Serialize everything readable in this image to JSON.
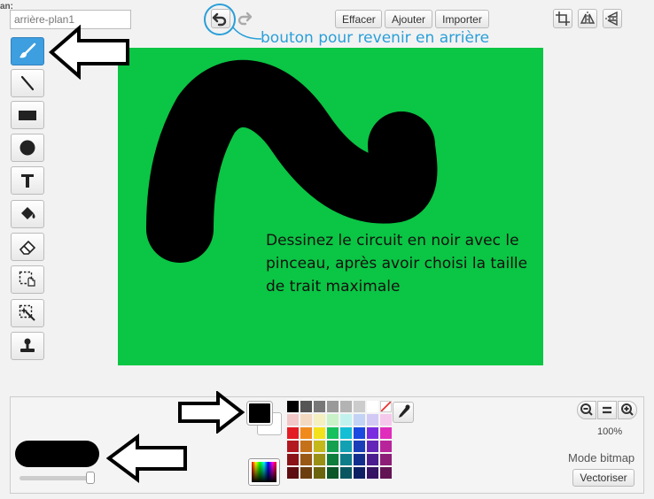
{
  "header": {
    "plan_label": "an:",
    "costume_name": "arrière-plan1",
    "effacer_label": "Effacer",
    "ajouter_label": "Ajouter",
    "importer_label": "Importer"
  },
  "annotations": {
    "undo_note": "bouton pour revenir en arrière",
    "canvas_note": "Dessinez le circuit en noir avec le pinceau, après  avoir choisi la taille de trait maximale"
  },
  "tools": [
    {
      "name": "brush-icon",
      "active": true
    },
    {
      "name": "line-icon"
    },
    {
      "name": "rectangle-icon"
    },
    {
      "name": "ellipse-icon"
    },
    {
      "name": "text-icon",
      "glyph": "T"
    },
    {
      "name": "fill-bucket-icon"
    },
    {
      "name": "eraser-icon"
    },
    {
      "name": "select-icon"
    },
    {
      "name": "magic-select-icon"
    },
    {
      "name": "stamp-icon"
    }
  ],
  "colors": {
    "canvas_bg": "#0bc544",
    "accent": "#3d9ee0",
    "note_blue": "#2a9fd8",
    "foreground": "#000000",
    "background": "#ffffff"
  },
  "palette": [
    "#000000",
    "#555555",
    "#777777",
    "#999999",
    "#b3b3b3",
    "#cccccc",
    "#ffffff",
    "none",
    "#f2c7c7",
    "#f3d9c0",
    "#f4f0c0",
    "#c9f2c9",
    "#c2f2ee",
    "#c2d3f5",
    "#d3c9f5",
    "#f5c9ec",
    "#e31b23",
    "#f18a1d",
    "#f3e21b",
    "#15c15d",
    "#14bfd5",
    "#1b4ae0",
    "#7a2de0",
    "#e02dbb",
    "#b21820",
    "#c4711a",
    "#c4b81a",
    "#14a04e",
    "#12a0b2",
    "#1a3db8",
    "#6325b8",
    "#b8259b",
    "#8a1418",
    "#9a5815",
    "#9a9015",
    "#0f7d3c",
    "#0e7d8a",
    "#132f8e",
    "#4c1d8e",
    "#8e1d78",
    "#5e0e10",
    "#6c3e0f",
    "#6c650f",
    "#0a5629",
    "#0a5660",
    "#0d2063",
    "#351463",
    "#631454"
  ],
  "zoom": {
    "level": "100%"
  },
  "mode": {
    "label": "Mode bitmap",
    "vectorize_label": "Vectoriser"
  }
}
